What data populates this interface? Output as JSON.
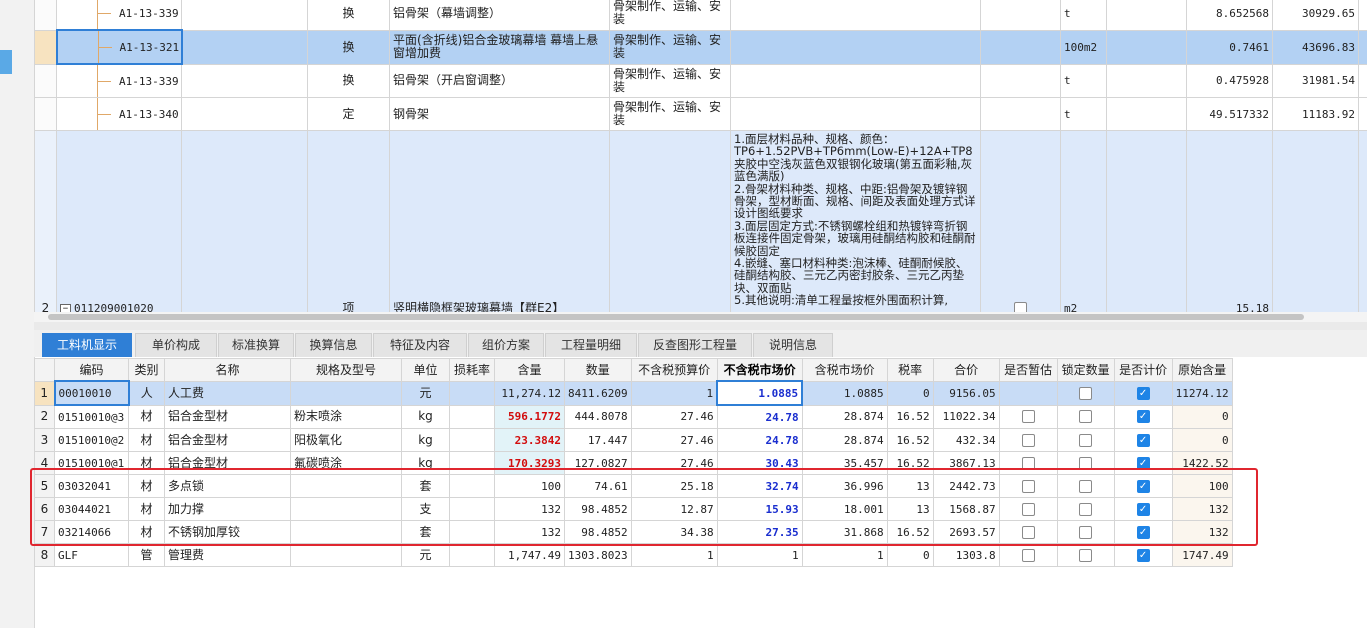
{
  "top_rows": [
    {
      "code": "A1-13-339",
      "type": "换",
      "name": "铝骨架（幕墙调整）",
      "work": "骨架制作、运输、安装",
      "desc": "",
      "unit": "t",
      "qty": "8.652568",
      "price": "30929.65"
    },
    {
      "code": "A1-13-321",
      "type": "换",
      "name": "平面(含折线)铝合金玻璃幕墙 幕墙上悬窗增加费",
      "work": "骨架制作、运输、安装",
      "desc": "",
      "unit": "100m2",
      "qty": "0.7461",
      "price": "43696.83"
    },
    {
      "code": "A1-13-339",
      "type": "换",
      "name": "铝骨架（开启窗调整）",
      "work": "骨架制作、运输、安装",
      "desc": "",
      "unit": "t",
      "qty": "0.475928",
      "price": "31981.54"
    },
    {
      "code": "A1-13-340",
      "type": "定",
      "name": "钢骨架",
      "work": "骨架制作、运输、安装",
      "desc": "",
      "unit": "t",
      "qty": "49.517332",
      "price": "11183.92"
    }
  ],
  "big_row": {
    "rownum": "2",
    "code": "011209001020",
    "type": "项",
    "name": "竖明横隐框架玻璃幕墙【群E2】",
    "desc": "1.面层材料品种、规格、颜色：TP6+1.52PVB+TP6mm(Low-E)+12A+TP8夹胶中空浅灰蓝色双银钢化玻璃(第五面彩釉,灰蓝色满版)\n2.骨架材料种类、规格、中距:铝骨架及镀锌钢骨架，型材断面、规格、间距及表面处理方式详设计图纸要求\n3.面层固定方式:不锈钢螺栓组和热镀锌弯折钢板连接件固定骨架，玻璃用硅酮结构胶和硅酮耐候胶固定\n4.嵌缝、塞口材料种类:泡沫棒、硅酮耐候胶、硅酮结构胶、三元乙丙密封胶条、三元乙丙垫块、双面贴\n5.其他说明:清单工程量按框外围面积计算,",
    "unit": "m2",
    "qty": "15.18"
  },
  "tabs": [
    "工料机显示",
    "单价构成",
    "标准换算",
    "换算信息",
    "特征及内容",
    "组价方案",
    "工程量明细",
    "反查图形工程量",
    "说明信息"
  ],
  "columns": [
    "编码",
    "类别",
    "名称",
    "规格及型号",
    "单位",
    "损耗率",
    "含量",
    "数量",
    "不含税预算价",
    "不含税市场价",
    "含税市场价",
    "税率",
    "合价",
    "是否暂估",
    "锁定数量",
    "是否计价",
    "原始含量"
  ],
  "rows": [
    {
      "n": "1",
      "code": "00010010",
      "cat": "人",
      "name": "人工费",
      "spec": "",
      "unit": "元",
      "loss": "",
      "content": "11,274.12",
      "qty": "8411.6209",
      "budget": "1",
      "market": "1.0885",
      "taxmarket": "1.0885",
      "rate": "0",
      "total": "9156.05",
      "est": "",
      "lock": false,
      "price": true,
      "orig": "11274.12"
    },
    {
      "n": "2",
      "code": "01510010@3",
      "cat": "材",
      "name": "铝合金型材",
      "spec": "粉末喷涂",
      "unit": "kg",
      "loss": "",
      "content": "596.1772",
      "qty": "444.8078",
      "budget": "27.46",
      "market": "24.78",
      "taxmarket": "28.874",
      "rate": "16.52",
      "total": "11022.34",
      "est": false,
      "lock": false,
      "price": true,
      "orig": "0"
    },
    {
      "n": "3",
      "code": "01510010@2",
      "cat": "材",
      "name": "铝合金型材",
      "spec": "阳极氧化",
      "unit": "kg",
      "loss": "",
      "content": "23.3842",
      "qty": "17.447",
      "budget": "27.46",
      "market": "24.78",
      "taxmarket": "28.874",
      "rate": "16.52",
      "total": "432.34",
      "est": false,
      "lock": false,
      "price": true,
      "orig": "0"
    },
    {
      "n": "4",
      "code": "01510010@1",
      "cat": "材",
      "name": "铝合金型材",
      "spec": "氟碳喷涂",
      "unit": "kg",
      "loss": "",
      "content": "170.3293",
      "qty": "127.0827",
      "budget": "27.46",
      "market": "30.43",
      "taxmarket": "35.457",
      "rate": "16.52",
      "total": "3867.13",
      "est": false,
      "lock": false,
      "price": true,
      "orig": "1422.52"
    },
    {
      "n": "5",
      "code": "03032041",
      "cat": "材",
      "name": "多点锁",
      "spec": "",
      "unit": "套",
      "loss": "",
      "content": "100",
      "qty": "74.61",
      "budget": "25.18",
      "market": "32.74",
      "taxmarket": "36.996",
      "rate": "13",
      "total": "2442.73",
      "est": false,
      "lock": false,
      "price": true,
      "orig": "100"
    },
    {
      "n": "6",
      "code": "03044021",
      "cat": "材",
      "name": "加力撑",
      "spec": "",
      "unit": "支",
      "loss": "",
      "content": "132",
      "qty": "98.4852",
      "budget": "12.87",
      "market": "15.93",
      "taxmarket": "18.001",
      "rate": "13",
      "total": "1568.87",
      "est": false,
      "lock": false,
      "price": true,
      "orig": "132"
    },
    {
      "n": "7",
      "code": "03214066",
      "cat": "材",
      "name": "不锈钢加厚铰",
      "spec": "",
      "unit": "套",
      "loss": "",
      "content": "132",
      "qty": "98.4852",
      "budget": "34.38",
      "market": "27.35",
      "taxmarket": "31.868",
      "rate": "16.52",
      "total": "2693.57",
      "est": false,
      "lock": false,
      "price": true,
      "orig": "132"
    },
    {
      "n": "8",
      "code": "GLF",
      "cat": "管",
      "name": "管理费",
      "spec": "",
      "unit": "元",
      "loss": "",
      "content": "1,747.49",
      "qty": "1303.8023",
      "budget": "1",
      "market": "1",
      "taxmarket": "1",
      "rate": "0",
      "total": "1303.8",
      "est": false,
      "lock": false,
      "price": true,
      "orig": "1747.49"
    }
  ],
  "colors": {
    "accent": "#2f7fd6",
    "selected": "#b3d1f3",
    "red_value": "#d20d0d",
    "blue_value": "#1a2ecf",
    "highlight_box": "#e0262f",
    "checkbox_on": "#1e84e6"
  }
}
